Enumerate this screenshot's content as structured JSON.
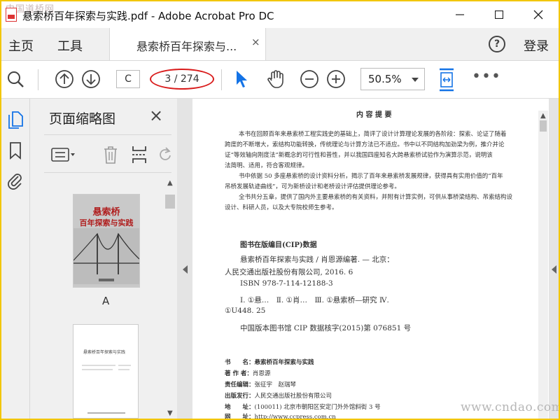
{
  "window": {
    "title": "悬索桥百年探索与实践.pdf - Adobe Acrobat Pro DC",
    "watermark_top": "中国道桥网",
    "controls": {
      "minimize": "—",
      "maximize": "☐",
      "close": "✕"
    }
  },
  "menubar": {
    "home": "主页",
    "tools": "工具",
    "document_tab": "悬索桥百年探索与...",
    "document_tab_close": "×",
    "help": "?",
    "sign_in": "登录"
  },
  "toolbar": {
    "page_input_value": "C",
    "page_count": "3 / 274",
    "zoom_value": "50.5%",
    "more": "•••",
    "accent_color": "#1473e6"
  },
  "thumbnail_panel": {
    "title": "页面缩略图",
    "close": "×",
    "cover_title_line1": "悬索桥",
    "cover_title_line2": "百年探索与实践",
    "thumb1_label": "A",
    "thumb2_title": "悬索桥百年探索与实践"
  },
  "document": {
    "heading": "内 容 提 要",
    "summary_lines": [
      "本书在回顾百年来悬索桥工程实践史的基础上，简评了设计计算理论发展的各阶段：探索、论证了随着",
      "跨度的不断增大，索结构功能转换，传统理论与计算方法已不适应。书中以不同结构加劲梁为例，推介并论",
      "证“等效轴向刚度法”新概念的可行性和普性，并以我国四座知名大跨悬索桥试验作为演算示范，说明该",
      "法简明、适用，符合客观规律。",
      "书中依据 50 多座悬索桥的设计资料分析，揭示了百年来悬索桥发展规律，获得具有实用价值的“百年",
      "吊桥发展轨迹曲线”，可为新桥设计和老桥设计评估提供理论参考。",
      "全书共分五章，提供了国内外主要悬索桥的有关资料，并附有计算实例，可供从事桥梁结构、吊索结构设",
      "设计、科研人员，以及大专院校师生参考。"
    ],
    "cip_heading": "图书在版编目(CIP)数据",
    "cip_lines": [
      "悬索桥百年探索与实践 / 肖恩源编著. — 北京：",
      "人民交通出版社股份有限公司, 2016. 6",
      "ISBN 978-7-114-12188-3",
      "Ⅰ. ①悬…　Ⅱ. ①肖…　Ⅲ. ①悬索桥—研究 Ⅳ.",
      "①U448. 25",
      "中国版本图书馆 CIP 数据核字(2015)第 076851 号"
    ],
    "colophon": [
      {
        "label": "书　　名：",
        "value": "悬索桥百年探索与实践"
      },
      {
        "label": "著 作 者：",
        "value": "肖恩源"
      },
      {
        "label": "责任编辑：",
        "value": "张征宇　赵瑞琴"
      },
      {
        "label": "出版发行：",
        "value": "人民交通出版社股份有限公司"
      },
      {
        "label": "地　　址：",
        "value": "(100011) 北京市朝阳区安定门外外馆斜街 3 号"
      },
      {
        "label": "网　　址：",
        "value": "http://www.ccpress.com.cn"
      }
    ],
    "watermark_bottom": "www.cndao.com"
  }
}
